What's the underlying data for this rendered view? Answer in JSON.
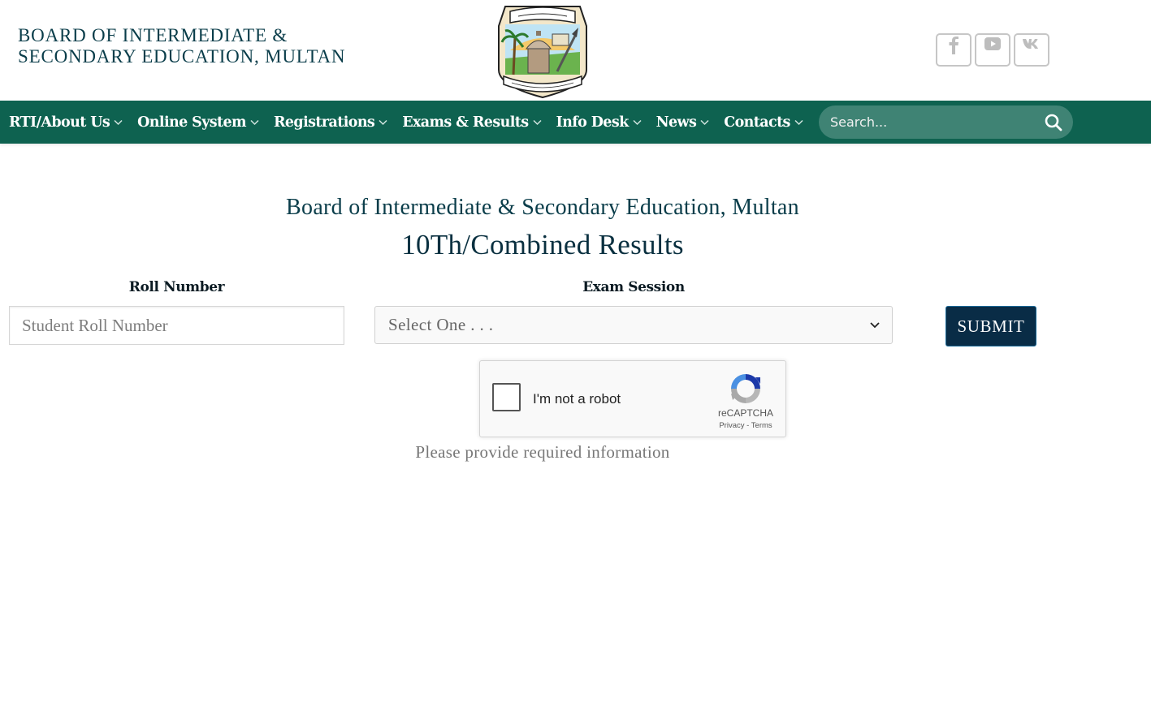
{
  "header": {
    "title_line1": "BOARD OF INTERMEDIATE &",
    "title_line2": "SECONDARY EDUCATION, MULTAN",
    "socials": [
      "facebook-icon",
      "youtube-icon",
      "vk-icon"
    ]
  },
  "nav": {
    "items": [
      {
        "label": "RTI/About Us"
      },
      {
        "label": "Online System"
      },
      {
        "label": "Registrations"
      },
      {
        "label": "Exams & Results"
      },
      {
        "label": "Info Desk"
      },
      {
        "label": "News"
      },
      {
        "label": "Contacts"
      }
    ],
    "search_placeholder": "Search..."
  },
  "main": {
    "board_name": "Board of Intermediate & Secondary Education, Multan",
    "page_title": "10Th/Combined Results",
    "roll_label": "Roll Number",
    "roll_placeholder": "Student Roll Number",
    "roll_value": "",
    "session_label": "Exam Session",
    "session_selected": "Select One . . .",
    "submit_label": "SUBMIT",
    "message": "Please provide required information"
  },
  "recaptcha": {
    "label": "I'm not a robot",
    "brand": "reCAPTCHA",
    "privacy": "Privacy",
    "separator": " - ",
    "terms": "Terms",
    "checked": false
  },
  "colors": {
    "nav_bg": "#0e6250",
    "search_bg": "#3f8374",
    "submit_bg": "#092c46",
    "title_text": "#0a3d4a"
  }
}
